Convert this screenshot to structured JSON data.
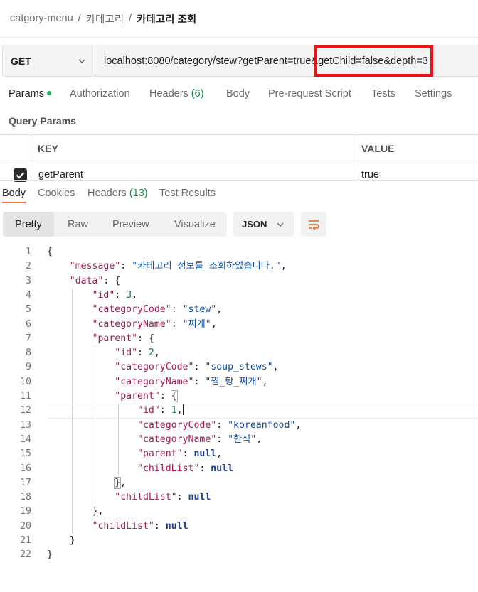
{
  "breadcrumb": {
    "collection": "catgory-menu",
    "folder": "카테고리",
    "request": "카테고리 조회",
    "separator": "/"
  },
  "request": {
    "method": "GET",
    "url": "localhost:8080/category/stew?getParent=true&getChild=false&depth=3",
    "highlight_text": "&getChild=false&depth=3",
    "highlight_color": "#e8141a"
  },
  "request_tabs": {
    "params": "Params",
    "authorization": "Authorization",
    "headers": "Headers",
    "headers_count": "(6)",
    "body": "Body",
    "pre_request": "Pre-request Script",
    "tests": "Tests",
    "settings": "Settings"
  },
  "query_params": {
    "title": "Query Params",
    "columns": {
      "key": "KEY",
      "value": "VALUE"
    },
    "row": {
      "key": "getParent",
      "value": "true",
      "checked": true
    }
  },
  "response_tabs": {
    "body": "Body",
    "cookies": "Cookies",
    "headers": "Headers",
    "headers_count": "(13)",
    "test_results": "Test Results"
  },
  "view_modes": {
    "pretty": "Pretty",
    "raw": "Raw",
    "preview": "Preview",
    "visualize": "Visualize"
  },
  "format": "JSON",
  "accent_color": "#ff6c37",
  "code": {
    "line_numbers": [
      "1",
      "2",
      "3",
      "4",
      "5",
      "6",
      "7",
      "8",
      "9",
      "10",
      "11",
      "12",
      "13",
      "14",
      "15",
      "16",
      "17",
      "18",
      "19",
      "20",
      "21",
      "22"
    ],
    "open_brace": "{",
    "close_brace": "}",
    "message_key": "\"message\"",
    "message_value": "\"카테고리 정보를 조회하였습니다.\"",
    "data_key": "\"data\"",
    "id_key": "\"id\"",
    "code_key": "\"categoryCode\"",
    "name_key": "\"categoryName\"",
    "parent_key": "\"parent\"",
    "child_key": "\"childList\"",
    "null_value": "null",
    "level1": {
      "id": "3",
      "code": "\"stew\"",
      "name": "\"찌개\""
    },
    "level2": {
      "id": "2",
      "code": "\"soup_stews\"",
      "name": "\"찜_탕_찌개\""
    },
    "level3": {
      "id": "1",
      "code": "\"koreanfood\"",
      "name": "\"한식\""
    }
  }
}
